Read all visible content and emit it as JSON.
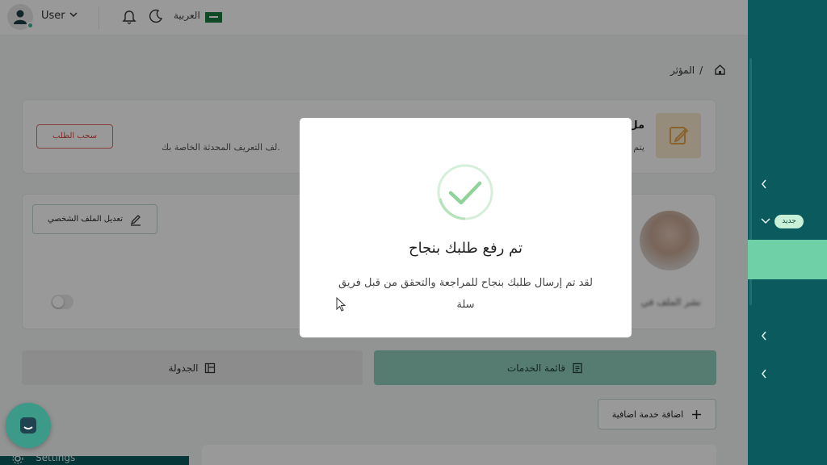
{
  "topbar": {
    "user_name": "User",
    "language_label": "العربية",
    "icons": [
      "user-avatar-icon",
      "chevron-down-icon",
      "bell-icon",
      "moon-icon",
      "saudi-flag-icon"
    ]
  },
  "breadcrumb": {
    "current": "المؤثر",
    "separator": "/"
  },
  "request_card": {
    "title_fragment": "مل",
    "subtitle_fragment": "يتم",
    "body_text": "لف التعريف المحدثة الخاصة بك.",
    "withdraw_label": "سحب الطلب"
  },
  "profile_card": {
    "edit_profile_label": "تعديل الملف الشخصي",
    "blurred_label": "نشر الملف في"
  },
  "tabs": {
    "services_label": "قائمة الخدمات",
    "schedule_label": "الجدولة"
  },
  "add_service_label": "اضافة خدمة اضافية",
  "sidebar": {
    "new_badge": "جديد"
  },
  "settings_label": "Settings",
  "modal": {
    "title": "تم رفع طلبك بنجاح",
    "message": "لقد تم إرسال طلبك بنجاح للمراجعة والتحقق من قبل فريق سلة",
    "icon": "success-check-icon"
  },
  "colors": {
    "brand_dark": "#0b5a5d",
    "brand_light": "#6fd0a8",
    "success": "#8fd39a",
    "danger": "#d64545"
  }
}
